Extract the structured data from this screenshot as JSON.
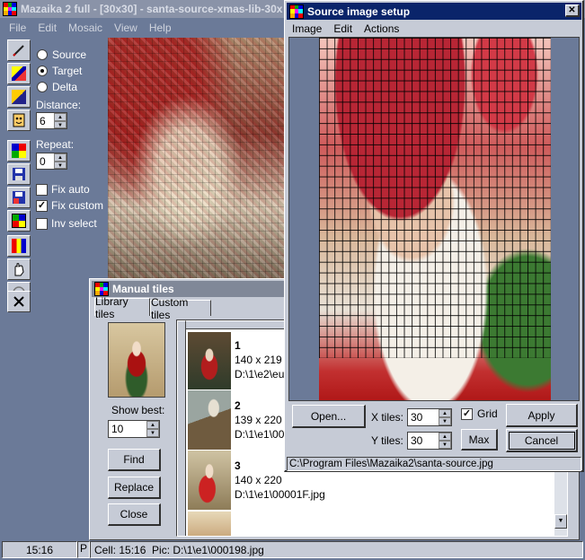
{
  "main_window": {
    "title": "Mazaika 2 full - [30x30] - santa-source-xmas-lib-30x",
    "menu": [
      "File",
      "Edit",
      "Mosaic",
      "View",
      "Help"
    ],
    "mode_options": [
      {
        "label": "Source",
        "selected": false
      },
      {
        "label": "Target",
        "selected": true
      },
      {
        "label": "Delta",
        "selected": false
      }
    ],
    "distance_label": "Distance:",
    "distance_value": "6",
    "repeat_label": "Repeat:",
    "repeat_value": "0",
    "checks": [
      {
        "label": "Fix auto",
        "checked": false
      },
      {
        "label": "Fix custom",
        "checked": true
      },
      {
        "label": "Inv select",
        "checked": false
      }
    ],
    "status": {
      "cell_coords": "15:16",
      "p": "P",
      "cell_info": "Cell: 15:16  Pic: D:\\1\\e1\\000198.jpg"
    },
    "tools": [
      "pencil-icon",
      "copy-tiles-icon",
      "paste-tiles-icon",
      "face-icon",
      "palette-icon",
      "save-icon",
      "save-as-icon",
      "grid-icon",
      "palette-hand-icon",
      "hand-icon",
      "circle-icon",
      "close-x-icon"
    ]
  },
  "manual_tiles": {
    "title": "Manual tiles",
    "tabs": [
      {
        "label": "Library tiles",
        "active": true
      },
      {
        "label": "Custom tiles",
        "active": false
      }
    ],
    "show_best_label": "Show best:",
    "show_best_value": "10",
    "buttons": {
      "find": "Find",
      "replace": "Replace",
      "close": "Close"
    },
    "tiles": [
      {
        "index": "1",
        "size": "140 x 219",
        "path": "D:\\1\\e2\\eu"
      },
      {
        "index": "2",
        "size": "139 x 220",
        "path": "D:\\1\\e1\\00"
      },
      {
        "index": "3",
        "size": "140 x 220",
        "path": "D:\\1\\e1\\00001F.jpg"
      }
    ]
  },
  "source_setup": {
    "title": "Source image setup",
    "menu": [
      "Image",
      "Edit",
      "Actions"
    ],
    "open_label": "Open...",
    "x_tiles_label": "X tiles:",
    "x_tiles_value": "30",
    "y_tiles_label": "Y tiles:",
    "y_tiles_value": "30",
    "grid_label": "Grid",
    "grid_checked": true,
    "apply_label": "Apply",
    "max_label": "Max",
    "cancel_label": "Cancel",
    "path": "C:\\Program Files\\Mazaika2\\santa-source.jpg"
  },
  "colors": {
    "titlebar_active": "#0a246a",
    "titlebar_inactive": "#808898",
    "face": "#c6cbd6",
    "desktop": "#6b7a98"
  }
}
